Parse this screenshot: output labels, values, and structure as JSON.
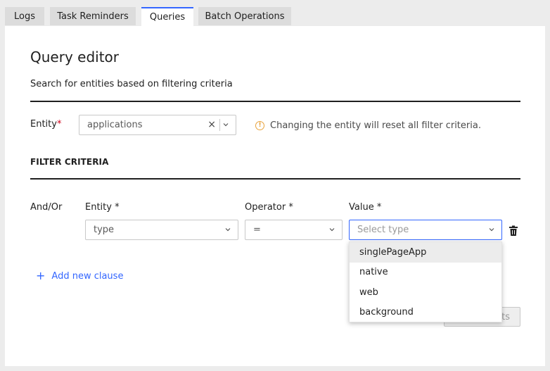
{
  "tabs": [
    {
      "label": "Logs"
    },
    {
      "label": "Task Reminders"
    },
    {
      "label": "Queries"
    },
    {
      "label": "Batch Operations"
    }
  ],
  "page": {
    "title": "Query editor",
    "subtitle": "Search for entities based on filtering criteria"
  },
  "entity_select": {
    "label": "Entity",
    "required_mark": "*",
    "value": "applications",
    "clear_glyph": "×",
    "info_text": "Changing the entity will reset all filter criteria."
  },
  "filter": {
    "section_title": "FILTER CRITERIA",
    "headers": {
      "and_or": "And/Or",
      "entity": "Entity *",
      "operator": "Operator *",
      "value": "Value *"
    },
    "clause": {
      "entity": "type",
      "operator": "=",
      "value_placeholder": "Select type"
    },
    "add_clause_label": "Add new clause",
    "value_options": [
      "singlePageApp",
      "native",
      "web",
      "background"
    ],
    "hovered_option": "singlePageApp"
  },
  "footer": {
    "hidden_button_visible_text": "ts"
  },
  "colors": {
    "accent": "#3366ff",
    "warning": "#e8a33d",
    "required": "#d0021b"
  },
  "icons": [
    "info-icon",
    "chevron-down-icon",
    "close-icon",
    "plus-icon",
    "trash-icon"
  ]
}
